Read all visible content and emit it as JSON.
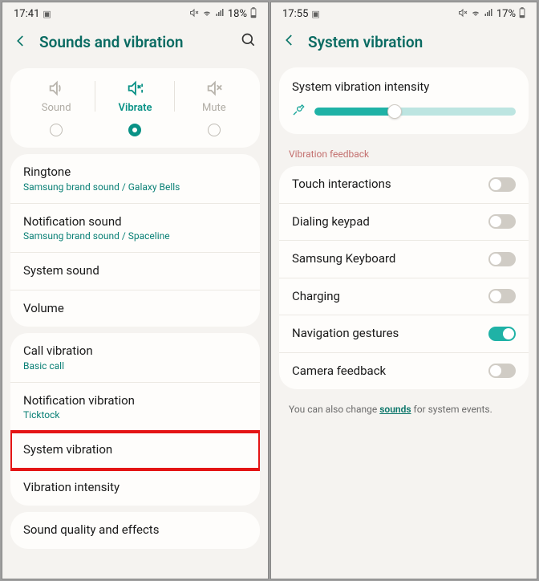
{
  "left": {
    "status": {
      "time": "17:41",
      "battery": "18%"
    },
    "title": "Sounds and vibration",
    "modes": [
      {
        "label": "Sound"
      },
      {
        "label": "Vibrate"
      },
      {
        "label": "Mute"
      }
    ],
    "group1": [
      {
        "title": "Ringtone",
        "sub": "Samsung brand sound / Galaxy Bells"
      },
      {
        "title": "Notification sound",
        "sub": "Samsung brand sound / Spaceline"
      },
      {
        "title": "System sound"
      },
      {
        "title": "Volume"
      }
    ],
    "group2": [
      {
        "title": "Call vibration",
        "sub": "Basic call"
      },
      {
        "title": "Notification vibration",
        "sub": "Ticktock"
      },
      {
        "title": "System vibration"
      },
      {
        "title": "Vibration intensity"
      }
    ],
    "group3": [
      {
        "title": "Sound quality and effects"
      }
    ]
  },
  "right": {
    "status": {
      "time": "17:55",
      "battery": "17%"
    },
    "title": "System vibration",
    "intensity_label": "System vibration intensity",
    "feedback_header": "Vibration feedback",
    "toggles": [
      {
        "label": "Touch interactions",
        "on": false
      },
      {
        "label": "Dialing keypad",
        "on": false
      },
      {
        "label": "Samsung Keyboard",
        "on": false
      },
      {
        "label": "Charging",
        "on": false
      },
      {
        "label": "Navigation gestures",
        "on": true
      },
      {
        "label": "Camera feedback",
        "on": false
      }
    ],
    "footer_pre": "You can also change ",
    "footer_link": "sounds",
    "footer_post": " for system events."
  }
}
